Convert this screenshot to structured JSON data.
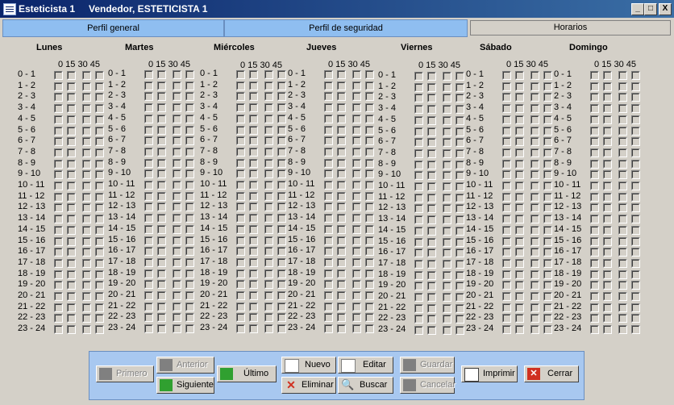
{
  "window": {
    "title_left": "Esteticista 1",
    "title_right": "Vendedor, ESTETICISTA 1",
    "min": "_",
    "max": "□",
    "close": "X"
  },
  "tabs": [
    {
      "label": "Perfil general"
    },
    {
      "label": "Perfil de seguridad"
    },
    {
      "label": "Horarios"
    }
  ],
  "schedule": {
    "minutes_header": "0 15 30 45",
    "days": [
      {
        "name": "Lunes"
      },
      {
        "name": "Martes"
      },
      {
        "name": "Miércoles"
      },
      {
        "name": "Jueves"
      },
      {
        "name": "Viernes"
      },
      {
        "name": "Sábado"
      },
      {
        "name": "Domingo"
      }
    ],
    "hours": [
      "0 - 1",
      "1 - 2",
      "2 - 3",
      "3 - 4",
      "4 - 5",
      "5 - 6",
      "6 - 7",
      "7 - 8",
      "8 - 9",
      "9 - 10",
      "10 - 11",
      "11 - 12",
      "12 - 13",
      "13 - 14",
      "14 - 15",
      "15 - 16",
      "16 - 17",
      "17 - 18",
      "18 - 19",
      "19 - 20",
      "20 - 21",
      "21 - 22",
      "22 - 23",
      "23 - 24"
    ]
  },
  "toolbar": {
    "primero": "Primero",
    "anterior": "Anterior",
    "siguiente": "Siguiente",
    "ultimo": "Último",
    "nuevo": "Nuevo",
    "editar": "Editar",
    "eliminar": "Eliminar",
    "buscar": "Buscar",
    "guardar": "Guardar",
    "cancelar": "Cancelar",
    "imprimir": "Imprimir",
    "cerrar": "Cerrar"
  },
  "colors": {
    "titlebar": "#0a246a",
    "tab_inactive": "#8fbef0",
    "toolbar_bg": "#a8c8f0",
    "enabled_icon": "#30a030",
    "delete_icon": "#d03020"
  }
}
